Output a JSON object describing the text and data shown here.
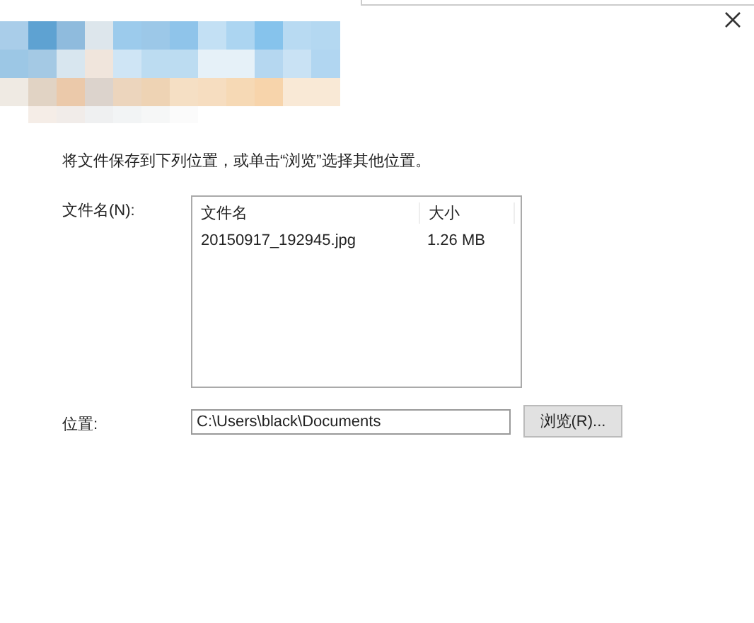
{
  "instruction": "将文件保存到下列位置，或单击“浏览”选择其他位置。",
  "file_list": {
    "label": "文件名(N):",
    "columns": [
      "文件名",
      "大小"
    ],
    "rows": [
      {
        "cells": [
          "20150917_192945.jpg",
          "1.26 MB"
        ],
        "selected": false
      }
    ]
  },
  "location": {
    "label": "位置:",
    "value": "C:\\Users\\black\\Documents"
  },
  "browse_button": "浏览(R)..."
}
